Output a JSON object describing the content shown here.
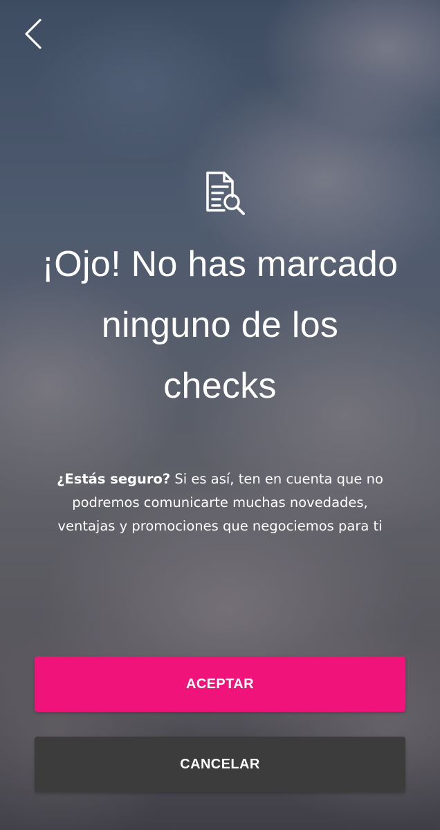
{
  "header": {
    "back_icon": "chevron-left-icon"
  },
  "dialog": {
    "icon": "document-search-icon",
    "title": "¡Ojo! No has marcado ninguno de los checks",
    "message_bold": "¿Estás seguro?",
    "message_rest": " Si es así, ten en cuenta que no podremos comunicarte muchas novedades, ventajas y promociones que negociemos para ti"
  },
  "actions": {
    "accept_label": "ACEPTAR",
    "cancel_label": "CANCELAR"
  },
  "colors": {
    "accent": "#f0137a",
    "secondary_button": "#3c3c3c",
    "text": "#ffffff"
  }
}
